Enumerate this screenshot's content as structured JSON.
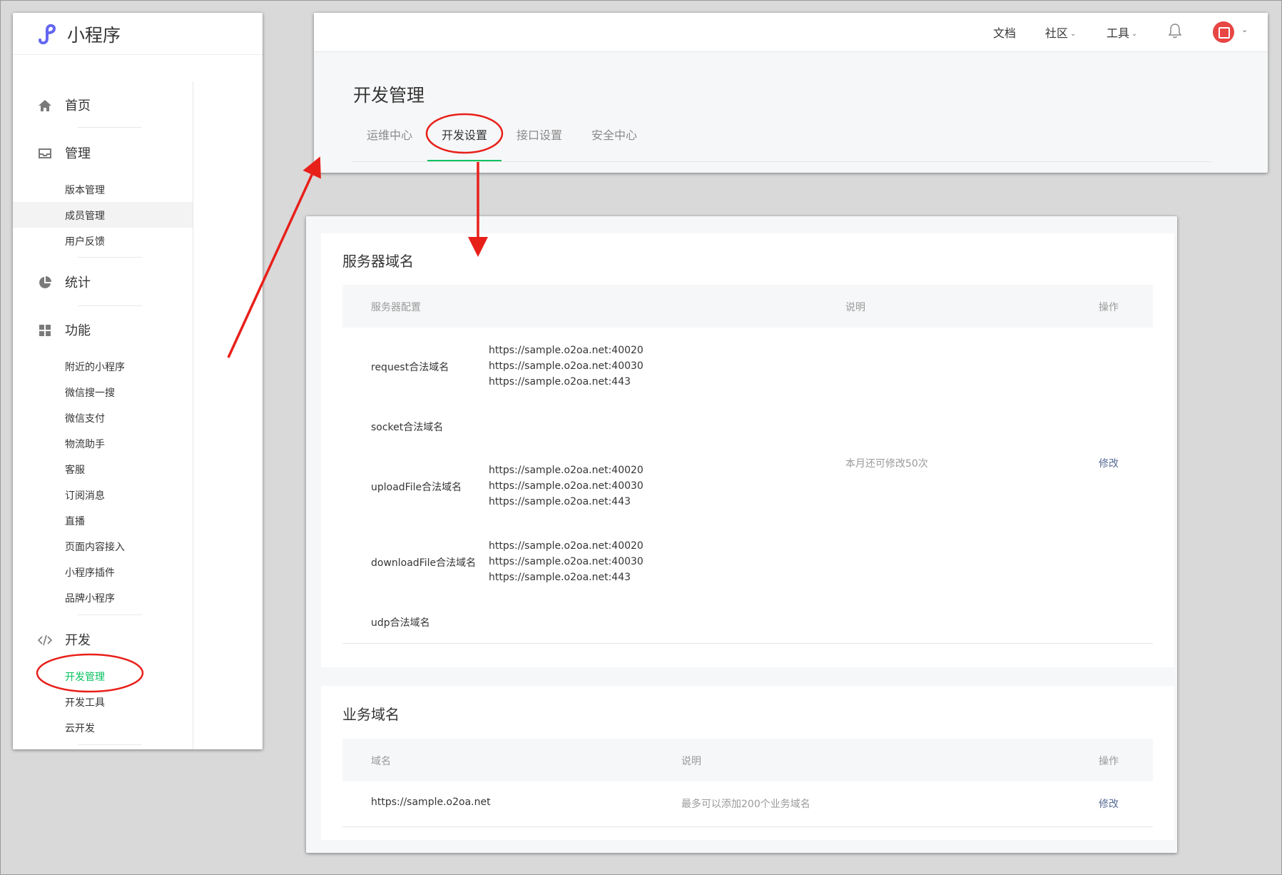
{
  "sidebar": {
    "app_name": "小程序",
    "sections": [
      {
        "label": "首页",
        "icon": "home-icon"
      },
      {
        "label": "管理",
        "icon": "inbox-icon"
      },
      {
        "label": "统计",
        "icon": "pie-chart-icon"
      },
      {
        "label": "功能",
        "icon": "grid-icon"
      },
      {
        "label": "开发",
        "icon": "code-icon"
      }
    ],
    "manage_items": [
      "版本管理",
      "成员管理",
      "用户反馈"
    ],
    "feature_items": [
      "附近的小程序",
      "微信搜一搜",
      "微信支付",
      "物流助手",
      "客服",
      "订阅消息",
      "直播",
      "页面内容接入",
      "小程序插件",
      "品牌小程序"
    ],
    "dev_items": [
      "开发管理",
      "开发工具",
      "云开发"
    ]
  },
  "topbar": {
    "docs": "文档",
    "community": "社区",
    "tools": "工具"
  },
  "page": {
    "title": "开发管理",
    "tabs": [
      "运维中心",
      "开发设置",
      "接口设置",
      "安全中心"
    ],
    "active_tab": "开发设置"
  },
  "server_domains": {
    "title": "服务器域名",
    "headers": {
      "config": "服务器配置",
      "desc": "说明",
      "op": "操作"
    },
    "rows": [
      {
        "name": "request合法域名",
        "urls": [
          "https://sample.o2oa.net:40020",
          "https://sample.o2oa.net:40030",
          "https://sample.o2oa.net:443"
        ]
      },
      {
        "name": "socket合法域名",
        "urls": []
      },
      {
        "name": "uploadFile合法域名",
        "urls": [
          "https://sample.o2oa.net:40020",
          "https://sample.o2oa.net:40030",
          "https://sample.o2oa.net:443"
        ]
      },
      {
        "name": "downloadFile合法域名",
        "urls": [
          "https://sample.o2oa.net:40020",
          "https://sample.o2oa.net:40030",
          "https://sample.o2oa.net:443"
        ]
      },
      {
        "name": "udp合法域名",
        "urls": []
      }
    ],
    "note": "本月还可修改50次",
    "action": "修改"
  },
  "business_domains": {
    "title": "业务域名",
    "headers": {
      "domain": "域名",
      "desc": "说明",
      "op": "操作"
    },
    "domain": "https://sample.o2oa.net",
    "note": "最多可以添加200个业务域名",
    "action": "修改"
  },
  "colors": {
    "accent_green": "#07c160",
    "link_blue": "#576b95",
    "annotation_red": "#e8201a"
  }
}
